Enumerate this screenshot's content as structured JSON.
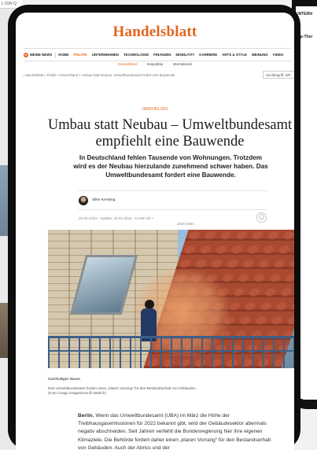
{
  "background": {
    "left_bar_text": "L ISIN Q",
    "right_tab_1": "UNTERN",
    "right_tab_2": "Top-Ther"
  },
  "site": {
    "logo": "Handelsblatt",
    "brand_color": "#e3641d"
  },
  "nav": {
    "news_badge": "H",
    "news_label": "MEINE NEWS",
    "items": [
      "HOME",
      "POLITIK",
      "UNTERNEHMEN",
      "TECHNOLOGIE",
      "FINANZEN",
      "MOBILITÄT",
      "KARRIERE",
      "ARTS & STYLE",
      "MEINUNG",
      "VIDEO"
    ],
    "active_item": "POLITIK"
  },
  "subnav": {
    "items": [
      "Deutschland",
      "Konjunktur",
      "International"
    ],
    "separator": "·",
    "active_item": "Deutschland"
  },
  "breadcrumb": "⌂ Handelsblatt  >  Politik  >  Deutschland  >  Umbau statt Neubau: Umweltbundesamt fordert eine Bauwende",
  "search": {
    "placeholder": "Suchbegriff, WK"
  },
  "article": {
    "kicker": "IMMOBILIEN",
    "headline_line1": "Umbau statt Neubau – Umweltbundesamt",
    "headline_line2": "empfiehlt eine Bauwende",
    "teaser": "In Deutschland fehlen Tausende von Wohnungen. Trotzdem wird es der Neubau hierzulande zunehmend schwer haben. Das Umweltbundesamt fordert eine Bauwende.",
    "author": "Silke Kersting",
    "dates": "20.02.2023 - Update: 20.02.2023 - 14:38 Uhr •",
    "listen": "Jetzt teilen",
    "bookmark_icon": "bookmark-icon",
    "image_caption_title": "Nachhaltiges Bauen",
    "image_caption": "Das Umweltbundesamt fordert einen „klaren Vorrang“ für den Bestandserhalt von Gebäuden.",
    "image_credit": "(Foto: imago images/Arnulf Hettrich)",
    "body_lead": "Berlin.",
    "body_text": " Wenn das Umweltbundesamt (UBA) im März die Höhe der Treibhausgasemissionen für 2022 bekannt gibt, wird der Gebäudesektor abermals negativ abschneiden. Seit Jahren verfehlt die Bundesregierung hier ihre eigenen Klimaziele. Die Behörde fordert daher einen „klaren Vorrang“ für den Bestandserhalt von Gebäuden. Auch der Abriss und der"
  }
}
